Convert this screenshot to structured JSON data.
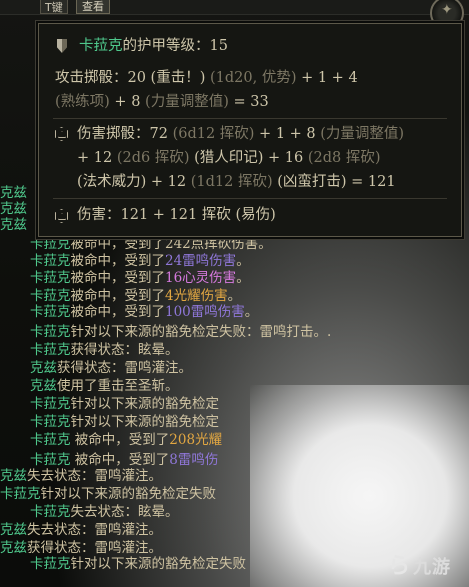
{
  "topbar": {
    "key_label": "T键",
    "view_label": "查看"
  },
  "log": {
    "lines": [
      {
        "segments": [
          {
            "t": "克兹",
            "c": "name"
          }
        ]
      },
      {
        "segments": [
          {
            "t": "克兹",
            "c": "name"
          }
        ]
      },
      {
        "segments": [
          {
            "t": "克兹",
            "c": "name"
          }
        ]
      },
      {
        "segments": [
          {
            "t": "卡菈克",
            "c": "name"
          },
          {
            "t": "被命中，受到了242点挥砍伤害。",
            "c": ""
          }
        ]
      },
      {
        "segments": [
          {
            "t": "卡菈克",
            "c": "name"
          },
          {
            "t": "被命中，受到了",
            "c": ""
          },
          {
            "t": "24雷鸣伤害",
            "c": "dmg-thunder"
          },
          {
            "t": "。",
            "c": ""
          }
        ]
      },
      {
        "segments": [
          {
            "t": "卡菈克",
            "c": "name"
          },
          {
            "t": "被命中，受到了",
            "c": ""
          },
          {
            "t": "16心灵伤害",
            "c": "dmg-psychic"
          },
          {
            "t": "。",
            "c": ""
          }
        ]
      },
      {
        "segments": [
          {
            "t": "卡菈克",
            "c": "name"
          },
          {
            "t": "被命中，受到了",
            "c": ""
          },
          {
            "t": "4光耀伤害",
            "c": "dmg-radiant"
          },
          {
            "t": "。",
            "c": ""
          }
        ]
      },
      {
        "segments": [
          {
            "t": "卡菈克",
            "c": "name"
          },
          {
            "t": "被命中，受到了",
            "c": ""
          },
          {
            "t": "100雷鸣伤害",
            "c": "dmg-thunder"
          },
          {
            "t": "。",
            "c": ""
          }
        ]
      },
      {
        "segments": [
          {
            "t": "卡菈克",
            "c": "name"
          },
          {
            "t": "针对以下来源的豁免检定失败：雷鸣打击。.",
            "c": ""
          }
        ]
      },
      {
        "segments": [
          {
            "t": "卡菈克",
            "c": "name"
          },
          {
            "t": "获得状态：眩晕。",
            "c": ""
          }
        ]
      },
      {
        "segments": [
          {
            "t": "克兹",
            "c": "name"
          },
          {
            "t": "获得状态：雷鸣灌注。",
            "c": ""
          }
        ]
      },
      {
        "segments": [
          {
            "t": "克兹",
            "c": "name"
          },
          {
            "t": "使用了重击至圣斩。",
            "c": ""
          }
        ]
      },
      {
        "segments": [
          {
            "t": "卡菈克",
            "c": "name"
          },
          {
            "t": "针对以下来源的豁免检定",
            "c": ""
          }
        ]
      },
      {
        "segments": [
          {
            "t": "卡菈克",
            "c": "name"
          },
          {
            "t": "针对以下来源的豁免检定",
            "c": ""
          }
        ]
      },
      {
        "segments": [
          {
            "t": "卡菈克",
            "c": "name"
          },
          {
            "t": " 被命中，受到了",
            "c": ""
          },
          {
            "t": "208光耀",
            "c": "dmg-radiant"
          }
        ]
      },
      {
        "segments": [
          {
            "t": "卡菈克",
            "c": "name"
          },
          {
            "t": " 被命中，受到了",
            "c": ""
          },
          {
            "t": "8雷鸣伤",
            "c": "dmg-thunder"
          }
        ]
      },
      {
        "segments": [
          {
            "t": "克兹",
            "c": "name"
          },
          {
            "t": "失去状态：雷鸣灌注。",
            "c": ""
          }
        ]
      },
      {
        "segments": [
          {
            "t": "卡菈克",
            "c": "name"
          },
          {
            "t": "针对以下来源的豁免检定失败",
            "c": ""
          }
        ]
      },
      {
        "segments": [
          {
            "t": "卡菈克",
            "c": "name"
          },
          {
            "t": "失去状态：眩晕。",
            "c": ""
          }
        ]
      },
      {
        "segments": [
          {
            "t": "克兹",
            "c": "name"
          },
          {
            "t": "失去状态：雷鸣灌注。",
            "c": ""
          }
        ]
      },
      {
        "segments": [
          {
            "t": "克兹",
            "c": "name"
          },
          {
            "t": "获得状态：雷鸣灌注。",
            "c": ""
          }
        ]
      },
      {
        "segments": [
          {
            "t": "卡菈克",
            "c": "name"
          },
          {
            "t": "针对以下来源的豁免检定失败",
            "c": ""
          }
        ]
      }
    ]
  },
  "tooltip": {
    "armor_name": "卡菈克",
    "armor_label": "的护甲等级：",
    "armor_value": "15",
    "attack_line1_a": "攻击掷骰：20 (重击！) ",
    "attack_line1_dim": "(1d20, 优势)",
    "attack_line1_b": " + 1 + 4",
    "attack_line2_dim1": "(熟练项)",
    "attack_line2_a": " + 8 ",
    "attack_line2_dim2": "(力量调整值)",
    "attack_line2_b": " = 33",
    "damage_line1_a": "伤害掷骰：72 ",
    "damage_line1_dim": "(6d12 挥砍)",
    "damage_line1_b": " + 1 + 8 ",
    "damage_line1_dim2": "(力量调整值)",
    "damage_line2_a": "+ 12 ",
    "damage_line2_dim": "(2d6 挥砍)",
    "damage_line2_b": " (猎人印记) + 16 ",
    "damage_line2_dim2": "(2d8 挥砍)",
    "damage_line3_a": "(法术威力) + 12 ",
    "damage_line3_dim": "(1d12 挥砍)",
    "damage_line3_b": " (凶蛮打击) = 121",
    "total_line": "伤害：121 + 121 挥砍 (易伤)"
  },
  "watermark": {
    "mark": "ら",
    "text": "九游"
  }
}
